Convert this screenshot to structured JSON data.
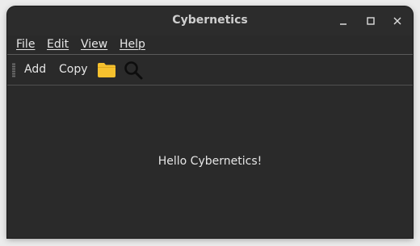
{
  "window": {
    "title": "Cybernetics",
    "controls": {
      "minimize_icon": "minimize-icon",
      "maximize_icon": "maximize-icon",
      "close_icon": "close-icon"
    }
  },
  "menubar": {
    "items": [
      {
        "label": "File"
      },
      {
        "label": "Edit"
      },
      {
        "label": "View"
      },
      {
        "label": "Help"
      }
    ]
  },
  "toolbar": {
    "add_label": "Add",
    "copy_label": "Copy",
    "folder_icon": "folder-icon",
    "search_icon": "search-icon",
    "folder_color": "#f6c12e"
  },
  "content": {
    "message": "Hello Cybernetics!"
  },
  "colors": {
    "window_bg": "#2a2a2a",
    "text": "#e6e6e6",
    "title_text": "#cfcfcf"
  }
}
